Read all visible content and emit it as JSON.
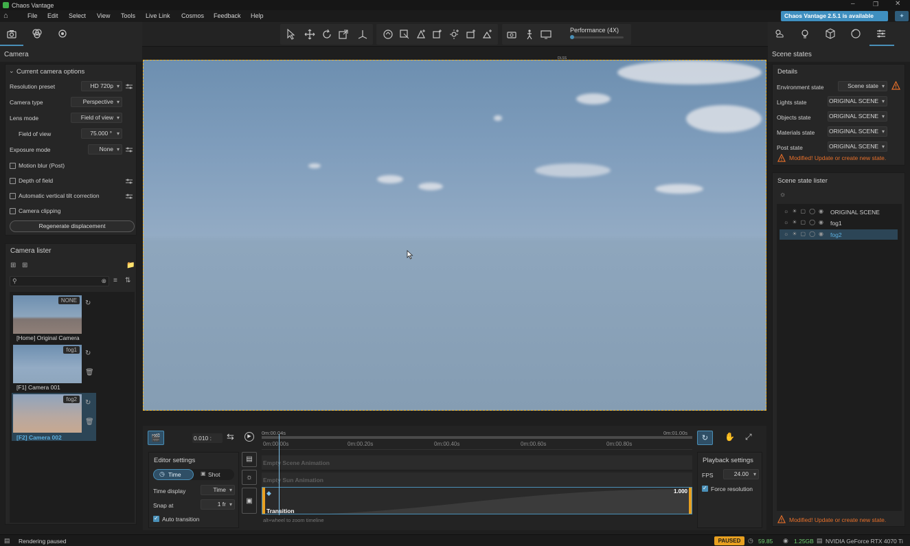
{
  "window": {
    "title": "Chaos Vantage",
    "update_notice": "Chaos Vantage 2.5.1 is available"
  },
  "menu": [
    "File",
    "Edit",
    "Select",
    "View",
    "Tools",
    "Live Link",
    "Cosmos",
    "Feedback",
    "Help"
  ],
  "toolbar": {
    "performance_label": "Performance (4X)",
    "dlss_label": "DLSS"
  },
  "camera_panel": {
    "title": "Camera",
    "section": "Current camera options",
    "resolution_preset_label": "Resolution preset",
    "resolution_preset_value": "HD 720p",
    "camera_type_label": "Camera type",
    "camera_type_value": "Perspective",
    "lens_mode_label": "Lens mode",
    "lens_mode_value": "Field of view",
    "fov_label": "Field of view",
    "fov_value": "75.000 °",
    "exposure_label": "Exposure mode",
    "exposure_value": "None",
    "motion_blur_label": "Motion blur (Post)",
    "dof_label": "Depth of field",
    "tilt_label": "Automatic vertical tilt correction",
    "clipping_label": "Camera clipping",
    "regen_button": "Regenerate displacement"
  },
  "camera_lister": {
    "title": "Camera lister",
    "cameras": [
      {
        "tag": "NONE",
        "label": "[Home] Original Camera"
      },
      {
        "tag": "fog1",
        "label": "[F1] Camera 001"
      },
      {
        "tag": "fog2",
        "label": "[F2] Camera 002"
      }
    ]
  },
  "scene_states": {
    "title": "Scene states",
    "details_title": "Details",
    "env_label": "Environment state",
    "env_value": "Scene state",
    "lights_label": "Lights state",
    "lights_value": "ORIGINAL SCENE",
    "objects_label": "Objects state",
    "objects_value": "ORIGINAL SCENE",
    "materials_label": "Materials state",
    "materials_value": "ORIGINAL SCENE",
    "post_label": "Post state",
    "post_value": "ORIGINAL SCENE",
    "modified_msg": "Modified! Update or create new state.",
    "lister_title": "Scene state lister",
    "states": [
      "ORIGINAL SCENE",
      "fog1",
      "fog2"
    ],
    "bottom_msg": "Modified! Update or create new state."
  },
  "timeline": {
    "time_value": "0.010 :",
    "playhead_time": "0m:00.04s",
    "end_time": "0m:01.00s",
    "ticks": [
      "0m:00.00s",
      "0m:00.20s",
      "0m:00.40s",
      "0m:00.60s",
      "0m:00.80s"
    ],
    "tracks": [
      "Empty Scene Animation",
      "Empty Sun Animation"
    ],
    "transition_label": "Transition",
    "transition_value": "1.000",
    "hint": "alt+wheel to zoom timeline"
  },
  "editor_settings": {
    "title": "Editor settings",
    "mode_time": "Time",
    "mode_shot": "Shot",
    "time_display_label": "Time display",
    "time_display_value": "Time",
    "snap_label": "Snap at",
    "snap_value": "1 fr",
    "auto_transition_label": "Auto transition"
  },
  "playback_settings": {
    "title": "Playback settings",
    "fps_label": "FPS",
    "fps_value": "24.00",
    "force_resolution_label": "Force resolution"
  },
  "status": {
    "text": "Rendering paused",
    "badge": "PAUSED",
    "fps": "59.85",
    "memory": "1.25GB",
    "gpu": "NVIDIA GeForce RTX 4070 Ti"
  },
  "colors": {
    "accent": "#4a90b8",
    "warning": "#e8702a",
    "paused": "#e8a020",
    "viewport_border": "#f0b62c"
  }
}
